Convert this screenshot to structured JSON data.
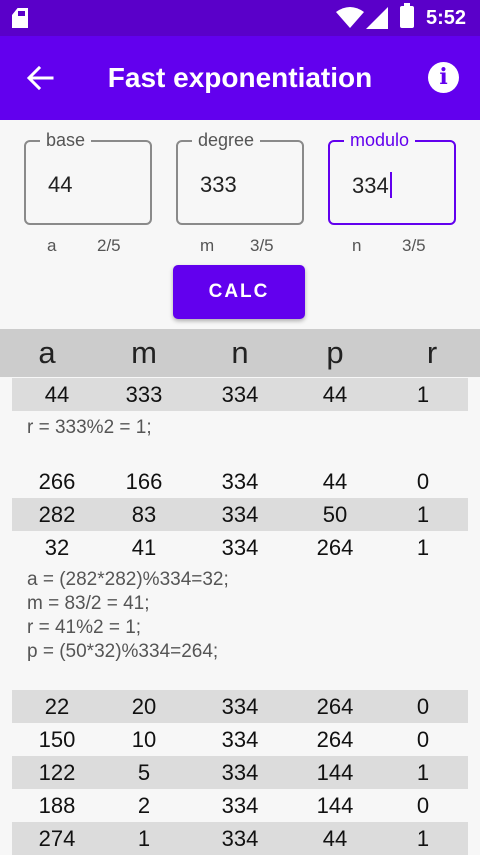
{
  "status": {
    "time": "5:52"
  },
  "appbar": {
    "title": "Fast exponentiation",
    "info_glyph": "i"
  },
  "fields": {
    "base": {
      "label": "base",
      "value": "44",
      "hint": "a",
      "count": "2/5"
    },
    "degree": {
      "label": "degree",
      "value": "333",
      "hint": "m",
      "count": "3/5"
    },
    "modulo": {
      "label": "modulo",
      "value": "334",
      "hint": "n",
      "count": "3/5"
    }
  },
  "calc_label": "CALC",
  "table": {
    "columns": [
      "a",
      "m",
      "n",
      "p",
      "r"
    ],
    "rows": [
      [
        "44",
        "333",
        "334",
        "44",
        "1"
      ],
      [
        "266",
        "166",
        "334",
        "44",
        "0"
      ],
      [
        "282",
        "83",
        "334",
        "50",
        "1"
      ],
      [
        "32",
        "41",
        "334",
        "264",
        "1"
      ],
      [
        "22",
        "20",
        "334",
        "264",
        "0"
      ],
      [
        "150",
        "10",
        "334",
        "264",
        "0"
      ],
      [
        "122",
        "5",
        "334",
        "144",
        "1"
      ],
      [
        "188",
        "2",
        "334",
        "144",
        "0"
      ],
      [
        "274",
        "1",
        "334",
        "44",
        "1"
      ]
    ],
    "notes": [
      [
        "r = 333%2 = 1;"
      ],
      [
        "a = (282*282)%334=32;",
        "m = 83/2 = 41;",
        "r = 41%2 = 1;",
        "p = (50*32)%334=264;"
      ]
    ]
  }
}
